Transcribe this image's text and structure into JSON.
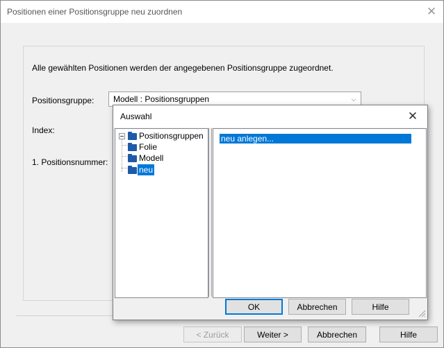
{
  "main_dialog": {
    "title": "Positionen einer Positionsgruppe neu zuordnen",
    "close_symbol": "✕",
    "intro_text": "Alle gewählten Positionen werden der angegebenen Positionsgruppe zugeordnet.",
    "group_label": "Positionsgruppe:",
    "group_value": "Modell : Positionsgruppen",
    "index_label": "Index:",
    "position_number_label": "1. Positionsnummer:",
    "buttons": {
      "back": "< Zurück",
      "next": "Weiter >",
      "cancel": "Abbrechen",
      "help": "Hilfe"
    }
  },
  "popup": {
    "title": "Auswahl",
    "close_symbol": "✕",
    "tree": {
      "root": "Positionsgruppen",
      "children": [
        "Folie",
        "Modell",
        "neu"
      ],
      "selected": "neu"
    },
    "list": {
      "items": [
        "neu anlegen..."
      ]
    },
    "buttons": {
      "ok": "OK",
      "cancel": "Abbrechen",
      "help": "Hilfe"
    }
  },
  "colors": {
    "selection": "#0078d7",
    "folder": "#1e5aa8",
    "dialog_bg": "#f0f0f0"
  }
}
